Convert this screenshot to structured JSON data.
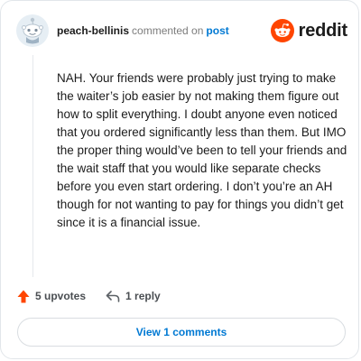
{
  "comment": {
    "username": "peach-bellinis",
    "action_text": "commented on",
    "post_link": "post",
    "body": "NAH. Your friends were probably just trying to make the waiter’s job easier by not making them figure out how to split everything. I doubt anyone even noticed that you ordered significantly less than them. But IMO the proper thing would’ve been to tell your friends and the wait staff that you would like separate checks before you even start ordering. I don’t you’re an AH though for not wanting to pay for things you didn’t get since it is a financial issue.",
    "upvotes_label": "5 upvotes",
    "replies_label": "1 reply",
    "view_comments_label": "View 1 comments"
  },
  "brand": {
    "name": "reddit",
    "logo_icon": "reddit-snoo-icon",
    "accent_color": "#ff4500"
  },
  "icons": {
    "avatar": "snoo-avatar-icon",
    "upvote": "upvote-arrow-icon",
    "reply": "reply-arrow-icon"
  },
  "colors": {
    "link": "#0079d3",
    "upvote": "#ff4500",
    "text": "#1c1c1c",
    "muted": "#7c7c7c"
  }
}
